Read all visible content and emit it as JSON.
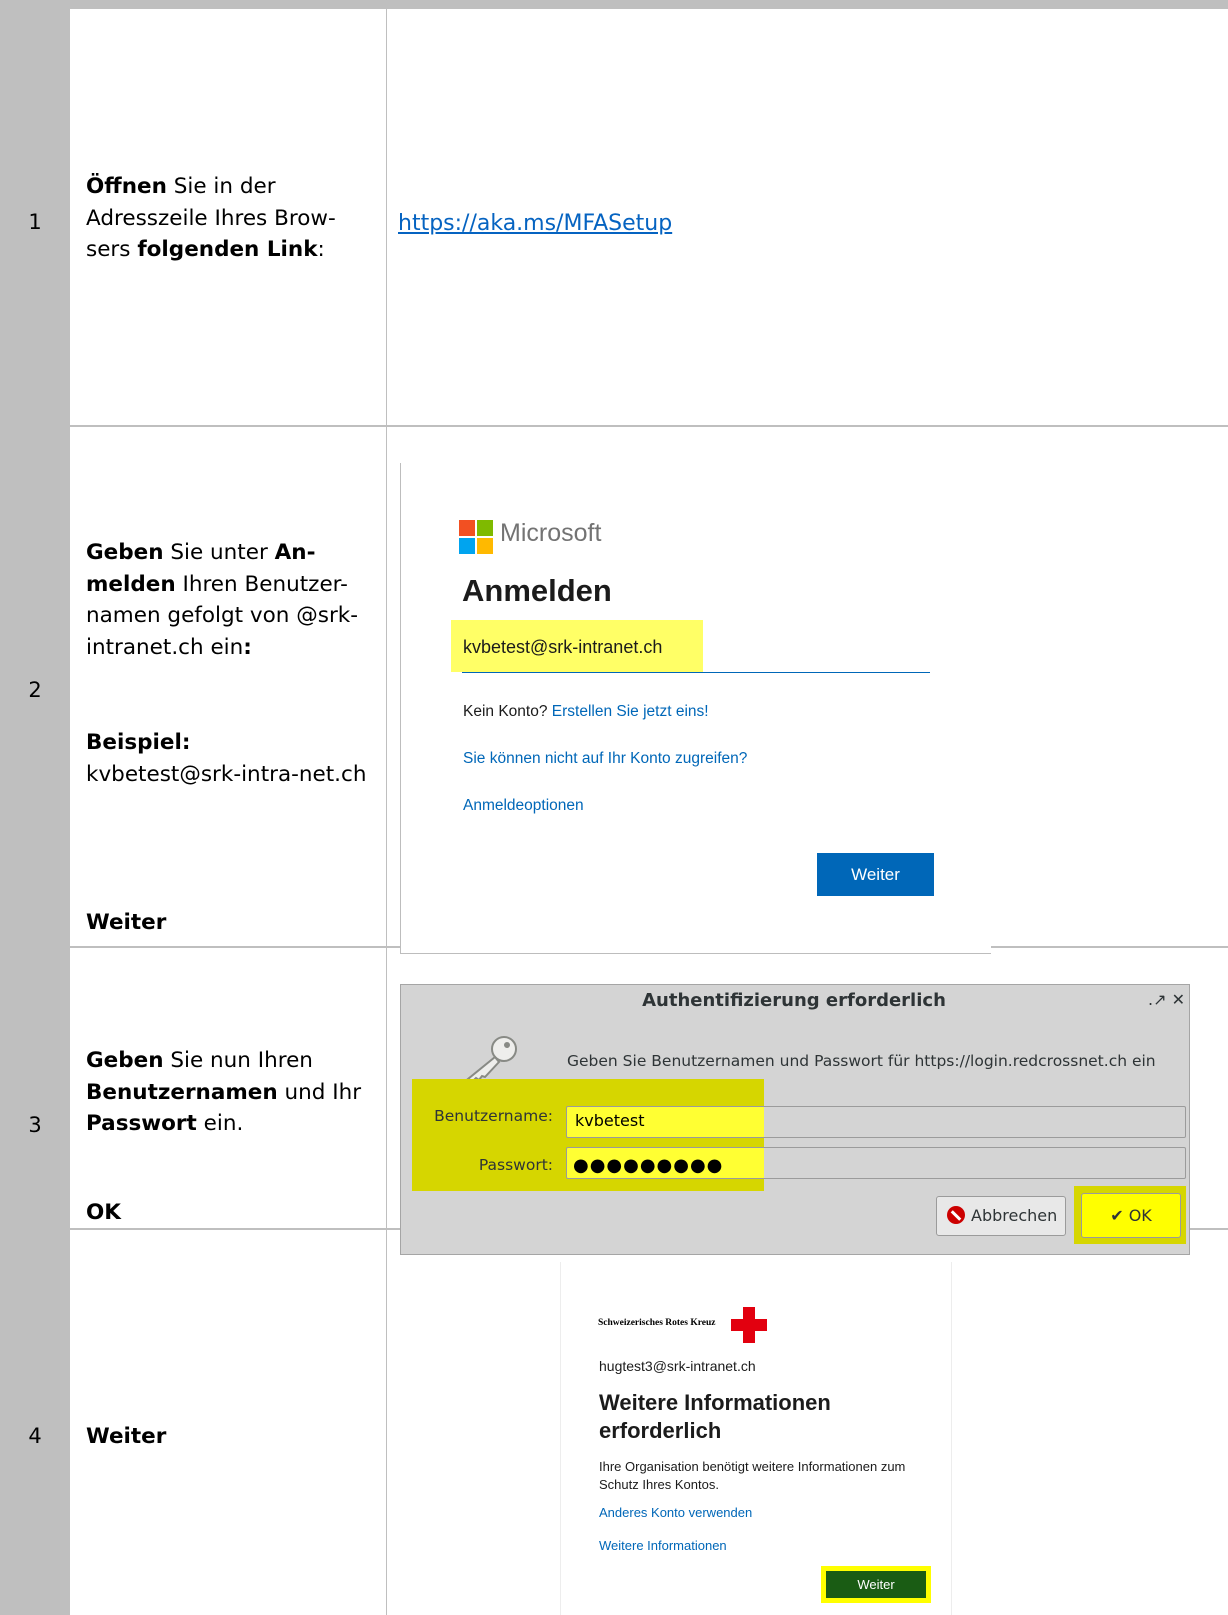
{
  "steps": [
    {
      "number": "1",
      "description": {
        "t1": "Öffnen",
        "t2": " Sie in der Adresszeile Ihres Brow-sers ",
        "t3": "folgenden Link",
        "t4": ":"
      },
      "link": "https://aka.ms/MFASetup"
    },
    {
      "number": "2",
      "description": {
        "t1": "Geben",
        "t2": " Sie unter ",
        "t3": "An-melden",
        "t4": " Ihren Benutzer-namen gefolgt von @srk-intranet.ch ein",
        "t5": ":",
        "example_label": "Beispiel:",
        "example_value": "kvbetest@srk-intra-net.ch",
        "action": "Weiter"
      },
      "signin": {
        "brand": "Microsoft",
        "title": "Anmelden",
        "username": "kvbetest@srk-intranet.ch",
        "no_account": "Kein Konto?",
        "create_link": "Erstellen Sie jetzt eins!",
        "cant_access": "Sie können nicht auf Ihr Konto zugreifen?",
        "options": "Anmeldeoptionen",
        "next_button": "Weiter",
        "logo_colors": [
          "#f25022",
          "#7fba00",
          "#00a4ef",
          "#ffb900"
        ]
      }
    },
    {
      "number": "3",
      "description": {
        "t1": "Geben",
        "t2": " Sie nun Ihren ",
        "t3": "Benutzernamen",
        "t4": " und Ihr ",
        "t5": "Passwort",
        "t6": " ein.",
        "action": "OK"
      },
      "dialog": {
        "title": "Authentifizierung erforderlich",
        "window_controls": ".↗ ✕",
        "message": "Geben Sie Benutzernamen und Passwort für https://login.redcrossnet.ch ein",
        "username_label": "Benutzername:",
        "username_value": "kvbetest",
        "password_label": "Passwort:",
        "password_value": "●●●●●●●●●",
        "cancel_button": "Abbrechen",
        "ok_button": "OK"
      }
    },
    {
      "number": "4",
      "description": {
        "action": "Weiter"
      },
      "srk": {
        "organization": "Schweizerisches Rotes Kreuz",
        "email": "hugtest3@srk-intranet.ch",
        "title": "Weitere Informationen erforderlich",
        "body": "Ihre Organisation benötigt weitere Informationen zum Schutz Ihres Kontos.",
        "other_account": "Anderes Konto verwenden",
        "more_info": "Weitere Informationen",
        "next_button": "Weiter"
      }
    }
  ]
}
